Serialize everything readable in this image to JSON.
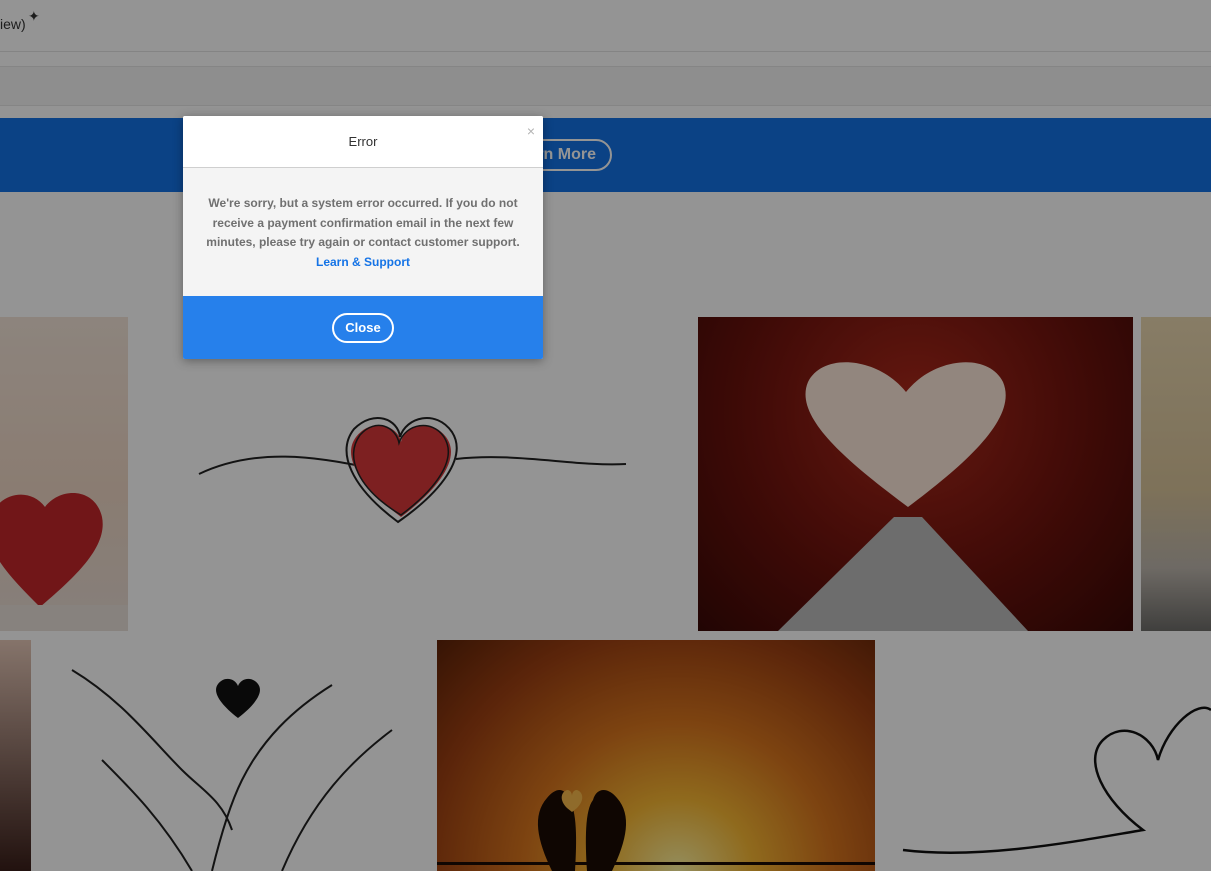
{
  "header": {
    "title_fragment": "iew)"
  },
  "banner": {
    "button_label": "rn More"
  },
  "modal": {
    "title": "Error",
    "close_x": "×",
    "message": "We're sorry, but a system error occurred. If you do not receive a payment confirmation email in the next few minutes, please try again or contact customer support.",
    "link_label": "Learn & Support",
    "close_label": "Close"
  },
  "colors": {
    "banner_blue": "#1473e6",
    "modal_footer_blue": "#2680eb",
    "link_blue": "#1473e6"
  }
}
